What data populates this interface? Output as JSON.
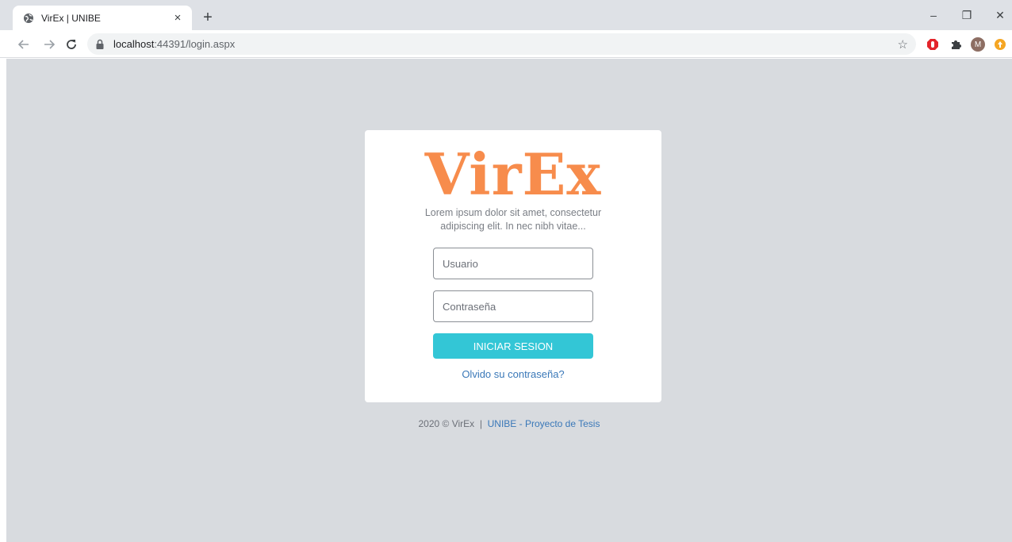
{
  "browser": {
    "tab_title": "VirEx | UNIBE",
    "tab_close": "×",
    "new_tab": "+",
    "url_host": "localhost",
    "url_rest": ":44391/login.aspx",
    "window_controls": {
      "minimize": "–",
      "restore": "❐",
      "close": "✕"
    },
    "profile_initial": "M"
  },
  "login": {
    "logo": "VirEx",
    "tagline": "Lorem ipsum dolor sit amet, consectetur adipiscing elit. In nec nibh vitae...",
    "username_placeholder": "Usuario",
    "password_placeholder": "Contraseña",
    "submit_label": "INICIAR SESION",
    "forgot_label": "Olvido su contraseña?"
  },
  "footer": {
    "copyright": "2020 © VirEx",
    "separator": "|",
    "link": "UNIBE - Proyecto de Tesis"
  },
  "colors": {
    "logo": "#f78c4c",
    "button": "#33c6d6",
    "link": "#3a78b8",
    "page_background": "#d8dbdf"
  }
}
